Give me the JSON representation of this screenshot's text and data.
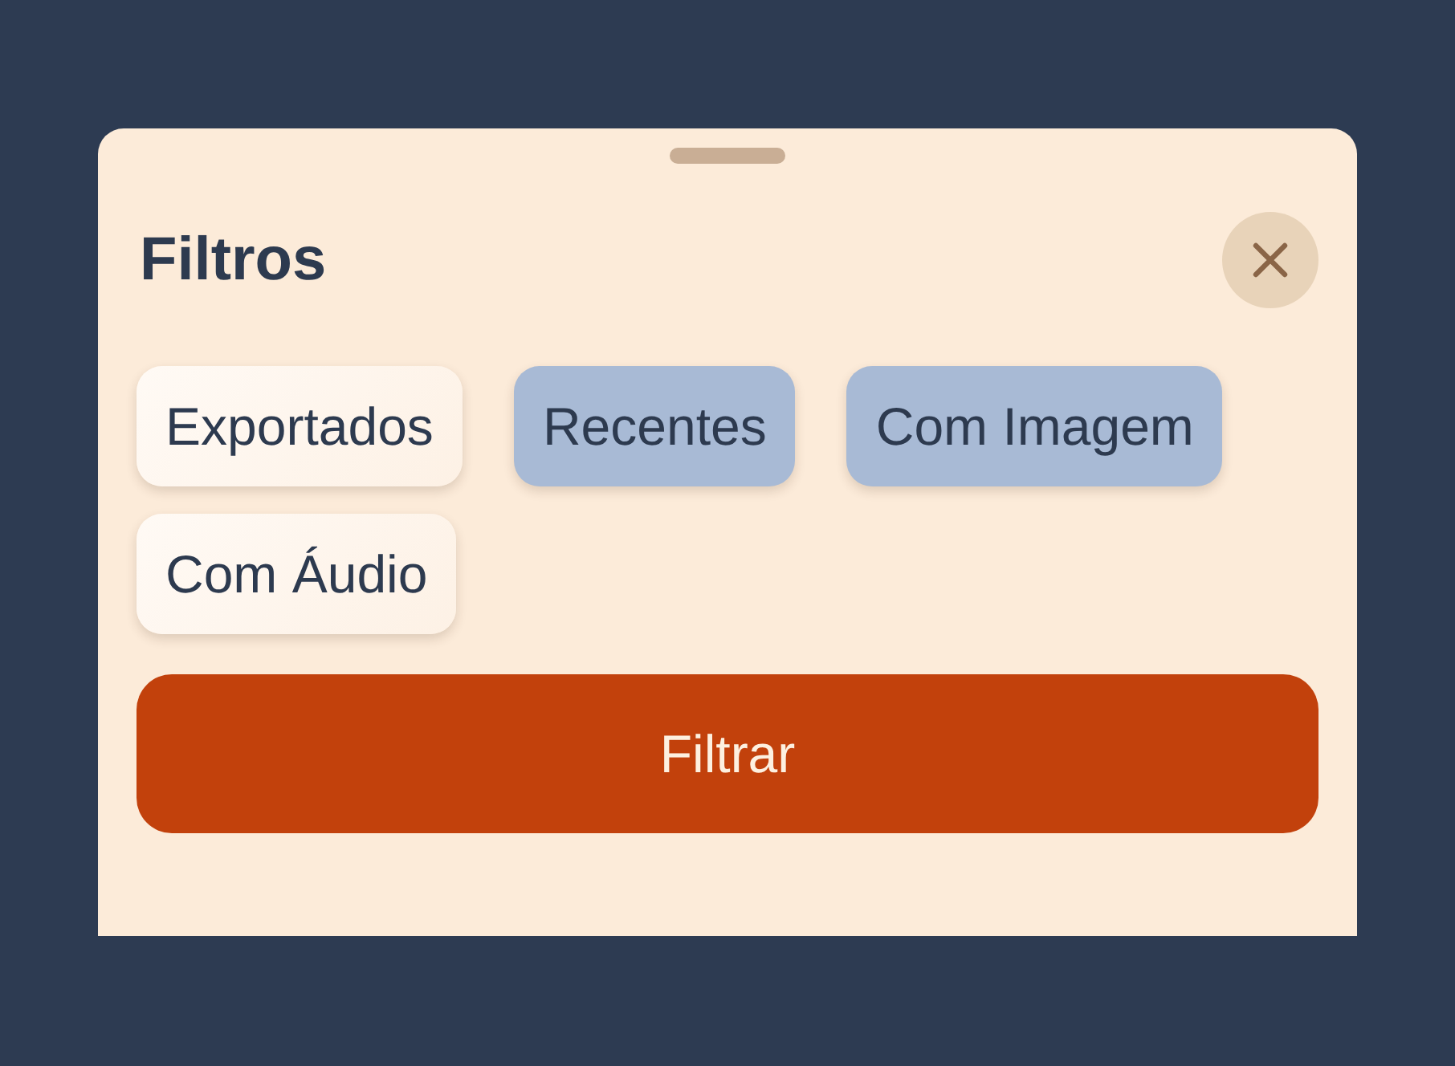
{
  "sheet": {
    "title": "Filtros"
  },
  "filters": [
    {
      "label": "Exportados",
      "selected": false
    },
    {
      "label": "Recentes",
      "selected": true
    },
    {
      "label": "Com Imagem",
      "selected": true
    },
    {
      "label": "Com Áudio",
      "selected": false
    }
  ],
  "apply_button": {
    "label": "Filtrar"
  }
}
